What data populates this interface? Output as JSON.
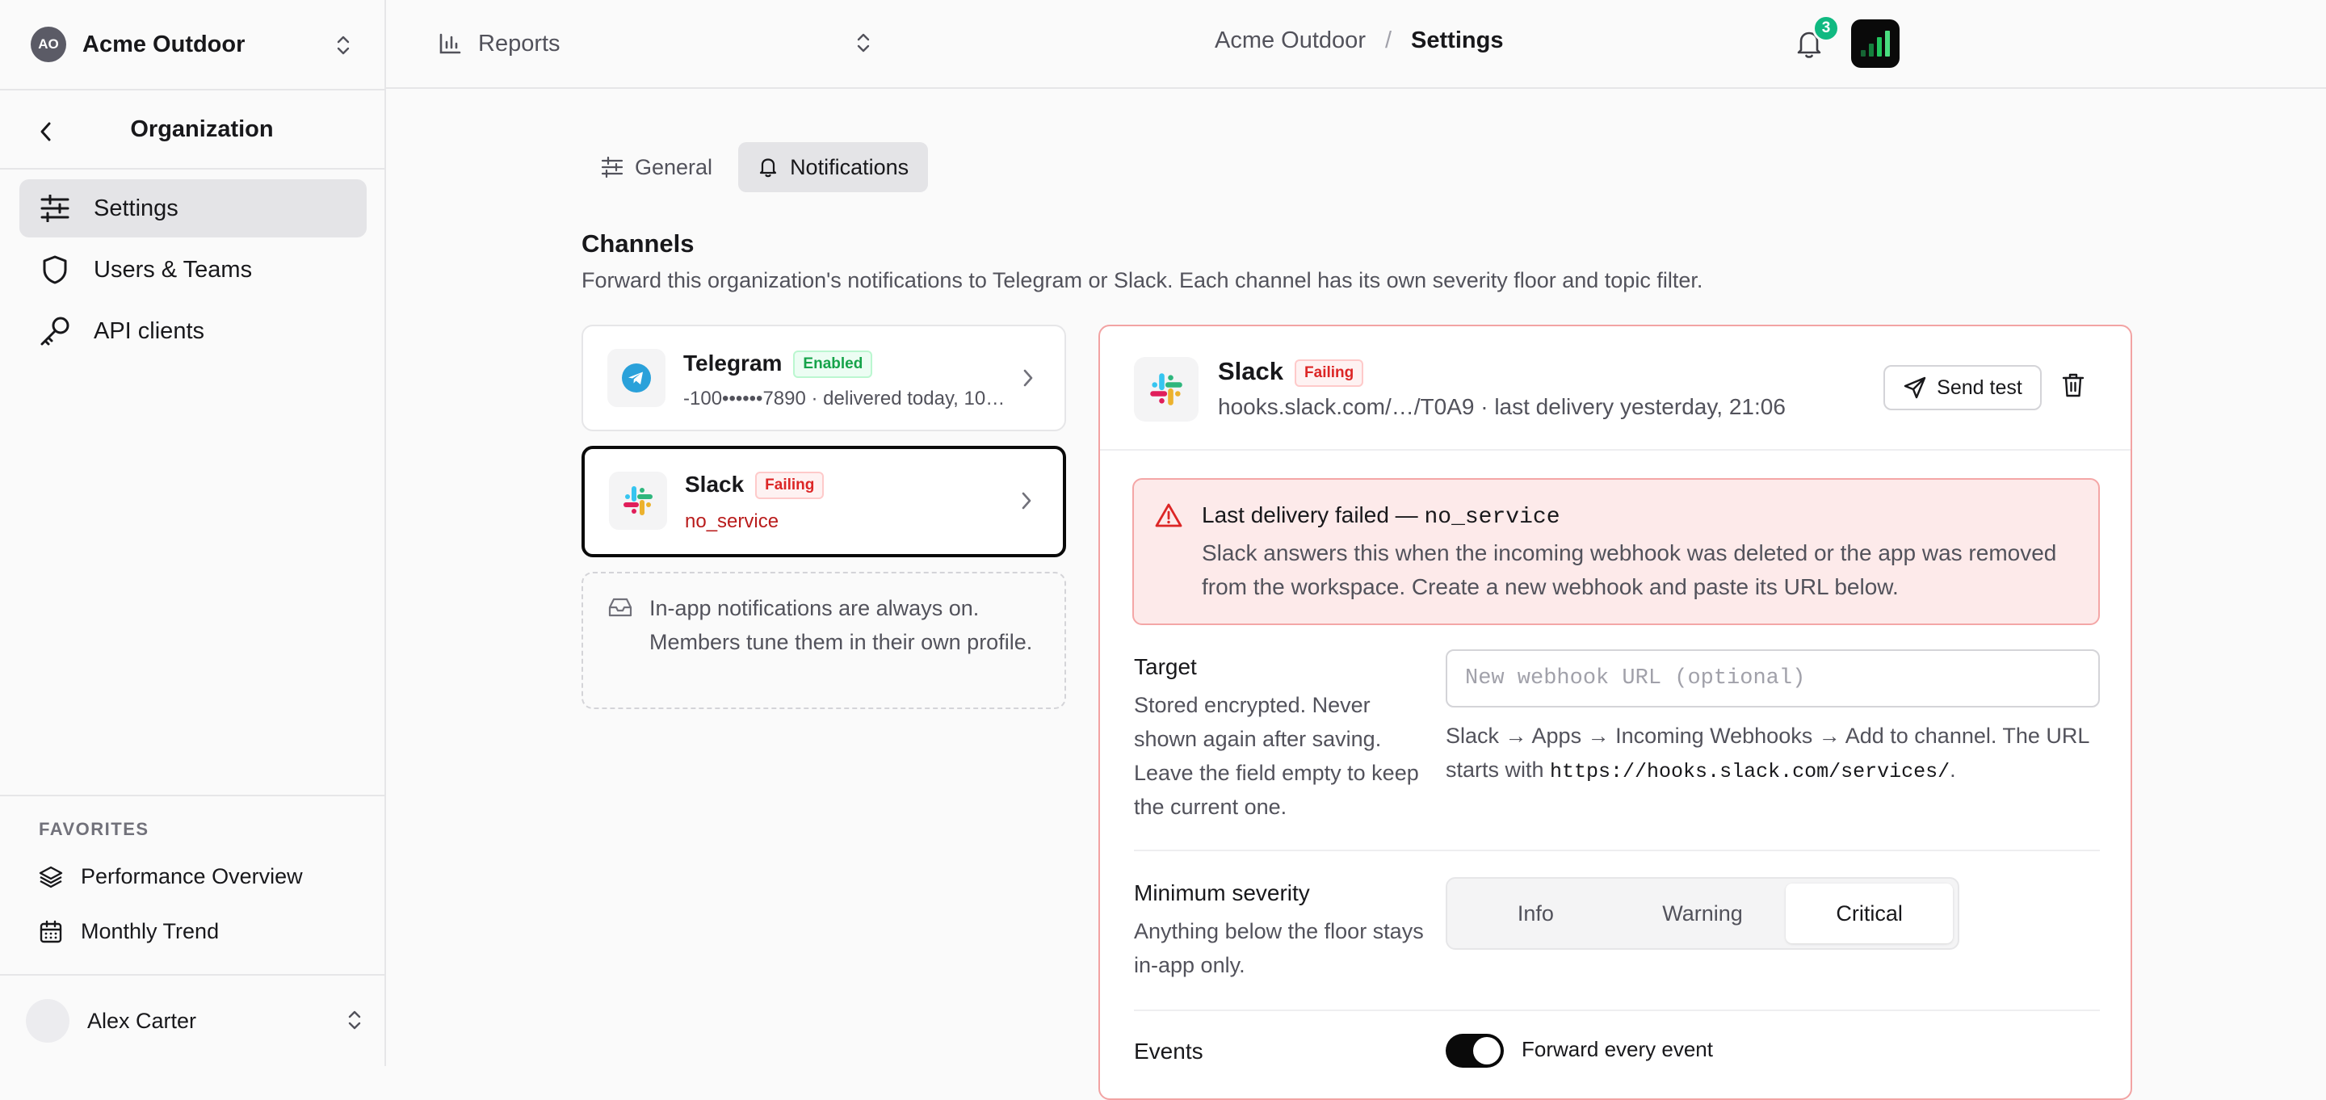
{
  "org": {
    "initials": "AO",
    "name": "Acme Outdoor"
  },
  "sidebar": {
    "section_title": "Organization",
    "items": [
      {
        "label": "Settings",
        "icon": "sliders-icon",
        "active": true
      },
      {
        "label": "Users & Teams",
        "icon": "shield-icon",
        "active": false
      },
      {
        "label": "API clients",
        "icon": "key-icon",
        "active": false
      }
    ],
    "favorites_label": "FAVORITES",
    "favorites": [
      {
        "label": "Performance Overview",
        "icon": "layers-icon"
      },
      {
        "label": "Monthly Trend",
        "icon": "calendar-icon"
      }
    ],
    "user": {
      "name": "Alex Carter"
    }
  },
  "topbar": {
    "reports_label": "Reports",
    "breadcrumb": {
      "parent": "Acme Outdoor",
      "separator": "/",
      "current": "Settings"
    },
    "notification_count": "3"
  },
  "tabs": [
    {
      "label": "General",
      "icon": "sliders-icon",
      "active": false
    },
    {
      "label": "Notifications",
      "icon": "bell-icon",
      "active": true
    }
  ],
  "channels": {
    "title": "Channels",
    "description": "Forward this organization's notifications to Telegram or Slack. Each channel has its own severity floor and topic filter.",
    "list": [
      {
        "name": "Telegram",
        "badge": "Enabled",
        "status": "ok",
        "subtitle": "-100••••••7890 · delivered today, 10…"
      },
      {
        "name": "Slack",
        "badge": "Failing",
        "status": "fail",
        "subtitle": "no_service"
      }
    ],
    "inapp_note": "In-app notifications are always on. Members tune them in their own profile."
  },
  "detail": {
    "name": "Slack",
    "badge": "Failing",
    "subtitle": "hooks.slack.com/…/T0A9 · last delivery yesterday, 21:06",
    "send_test_label": "Send test",
    "alert": {
      "title_prefix": "Last delivery failed — ",
      "title_code": "no_service",
      "body": "Slack answers this when the incoming webhook was deleted or the app was removed from the workspace. Create a new webhook and paste its URL below."
    },
    "target": {
      "label": "Target",
      "help": "Stored encrypted. Never shown again after saving. Leave the field empty to keep the current one.",
      "placeholder": "New webhook URL (optional)",
      "value": "",
      "url_help_prefix": "Slack → Apps → Incoming Webhooks → Add to channel. The URL starts with ",
      "url_help_code": "https://hooks.slack.com/services/",
      "url_help_suffix": "."
    },
    "severity": {
      "label": "Minimum severity",
      "help": "Anything below the floor stays in-app only.",
      "options": [
        "Info",
        "Warning",
        "Critical"
      ],
      "selected": "Critical"
    },
    "events": {
      "label": "Events",
      "toggle_label": "Forward every event",
      "toggle_on": true
    }
  },
  "colors": {
    "accent_green": "#10b981",
    "error_red": "#dc2626",
    "ok_green": "#16a34a"
  }
}
